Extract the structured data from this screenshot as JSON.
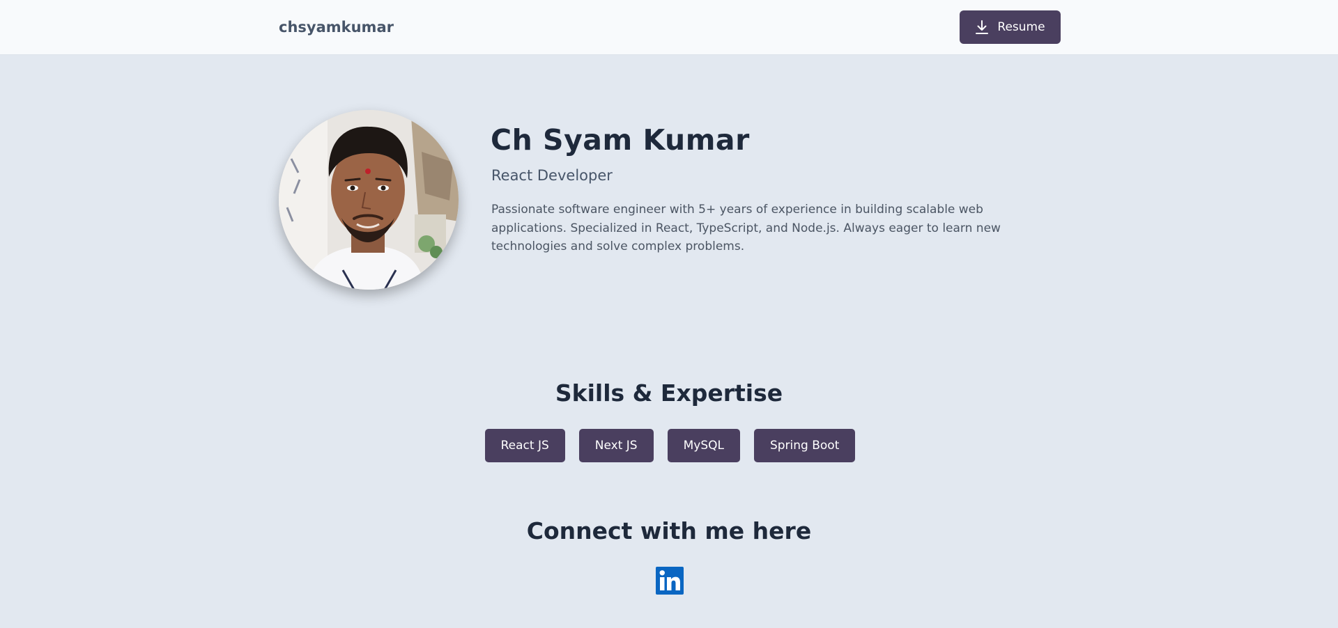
{
  "header": {
    "brand": "chsyamkumar",
    "resume_button": {
      "label": "Resume",
      "icon": "download-icon"
    }
  },
  "hero": {
    "avatar": "profile-photo",
    "name": "Ch Syam Kumar",
    "role": "React Developer",
    "bio": "Passionate software engineer with 5+ years of experience in building scalable web applications. Specialized in React, TypeScript, and Node.js. Always eager to learn new technologies and solve complex problems."
  },
  "skills": {
    "title": "Skills & Expertise",
    "items": [
      "React JS",
      "Next JS",
      "MySQL",
      "Spring Boot"
    ]
  },
  "connect": {
    "title": "Connect with me here",
    "links": [
      {
        "icon": "linkedin-icon"
      }
    ]
  },
  "colors": {
    "page_background": "#e2e8f0",
    "navbar_background": "#f8fafc",
    "accent": "#4a3f5f",
    "heading_text": "#1e293b",
    "body_text": "#4b5563",
    "linkedin_blue": "#0a66c2"
  }
}
